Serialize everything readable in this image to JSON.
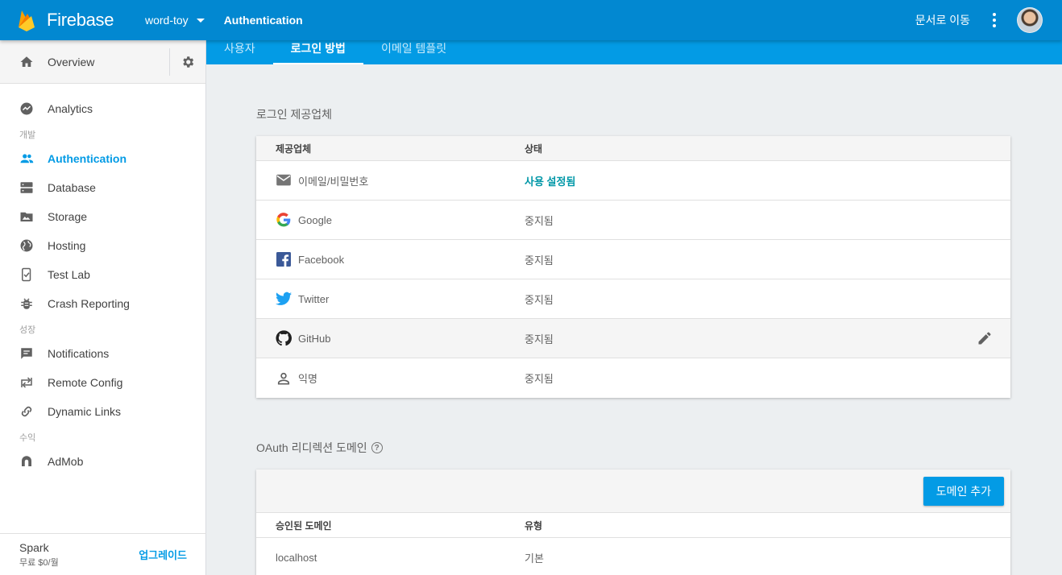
{
  "topbar": {
    "brand": "Firebase",
    "project": "word-toy",
    "section": "Authentication",
    "docs_link": "문서로 이동"
  },
  "tabs": [
    {
      "label": "사용자"
    },
    {
      "label": "로그인 방법"
    },
    {
      "label": "이메일 템플릿"
    }
  ],
  "sidebar": {
    "overview": "Overview",
    "analytics": "Analytics",
    "sections": {
      "develop": "개발",
      "grow": "성장",
      "earn": "수익"
    },
    "develop_items": [
      {
        "label": "Authentication"
      },
      {
        "label": "Database"
      },
      {
        "label": "Storage"
      },
      {
        "label": "Hosting"
      },
      {
        "label": "Test Lab"
      },
      {
        "label": "Crash Reporting"
      }
    ],
    "grow_items": [
      {
        "label": "Notifications"
      },
      {
        "label": "Remote Config"
      },
      {
        "label": "Dynamic Links"
      }
    ],
    "earn_items": [
      {
        "label": "AdMob"
      }
    ],
    "plan": {
      "name": "Spark",
      "price": "무료 $0/월",
      "upgrade": "업그레이드"
    }
  },
  "providers": {
    "heading": "로그인 제공업체",
    "col_provider": "제공업체",
    "col_status": "상태",
    "rows": [
      {
        "name": "이메일/비밀번호",
        "status": "사용 설정됨",
        "icon": "email-icon"
      },
      {
        "name": "Google",
        "status": "중지됨",
        "icon": "google-icon"
      },
      {
        "name": "Facebook",
        "status": "중지됨",
        "icon": "facebook-icon"
      },
      {
        "name": "Twitter",
        "status": "중지됨",
        "icon": "twitter-icon"
      },
      {
        "name": "GitHub",
        "status": "중지됨",
        "icon": "github-icon"
      },
      {
        "name": "익명",
        "status": "중지됨",
        "icon": "person-icon"
      }
    ]
  },
  "domains": {
    "heading": "OAuth 리디렉션 도메인",
    "add_button": "도메인 추가",
    "col_domain": "승인된 도메인",
    "col_type": "유형",
    "rows": [
      {
        "domain": "localhost",
        "type": "기본"
      }
    ]
  },
  "colors": {
    "topbar": "#0288d1",
    "tabstrip": "#039be5",
    "accent": "#039be5",
    "enabled": "#0097a7"
  }
}
